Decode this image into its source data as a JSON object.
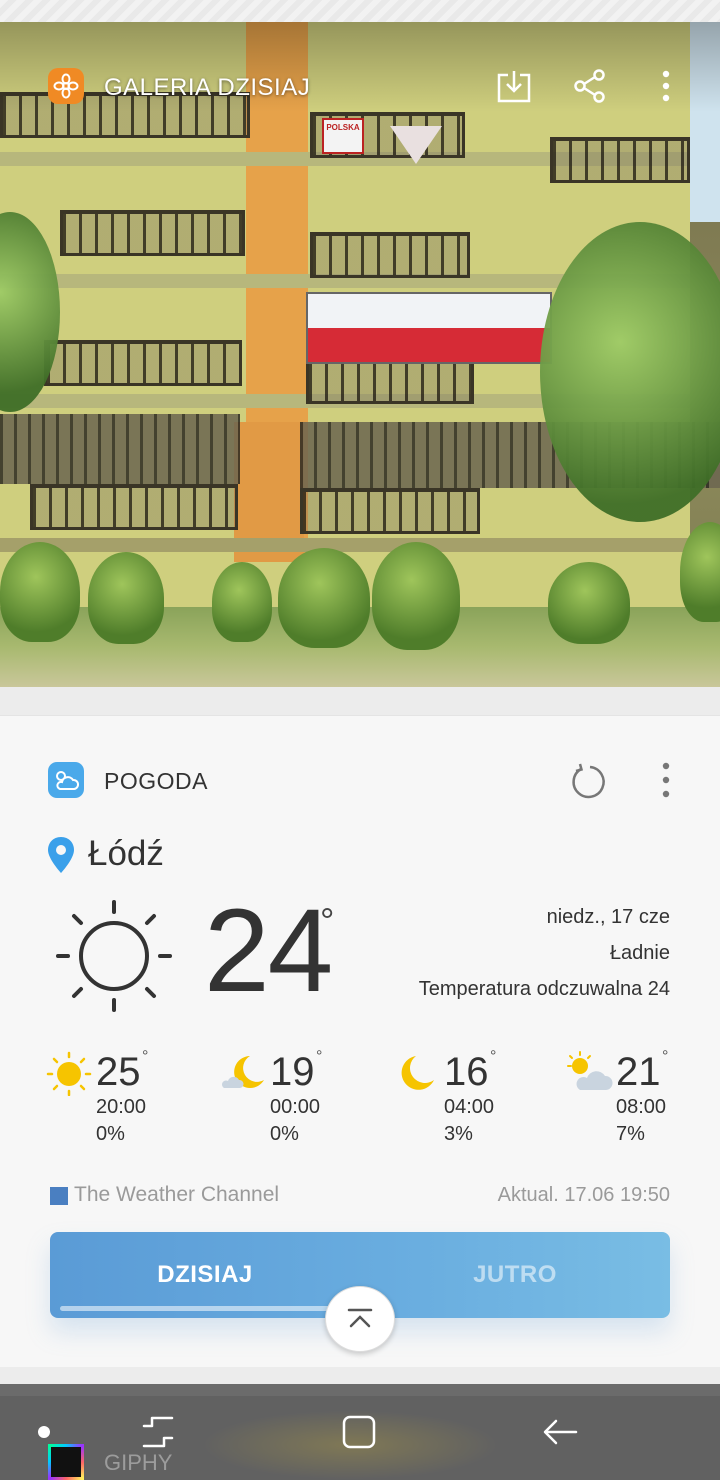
{
  "gallery": {
    "title": "GALERIA DZISIAJ",
    "flag_banner_text": "POLSKA",
    "icons": [
      "flower-icon",
      "save-to-gallery-icon",
      "share-icon",
      "more-icon"
    ]
  },
  "weather": {
    "app_title": "POGODA",
    "location": "Łódź",
    "current": {
      "temperature": "24",
      "degree_symbol": "°",
      "date": "niedz., 17 cze",
      "condition": "Ładnie",
      "feels_like": "Temperatura odczuwalna 24",
      "icon": "sun-icon"
    },
    "hourly": [
      {
        "temp": "25",
        "deg": "°",
        "time": "20:00",
        "precip": "0%",
        "icon": "sun-icon"
      },
      {
        "temp": "19",
        "deg": "°",
        "time": "00:00",
        "precip": "0%",
        "icon": "moon-cloud-icon"
      },
      {
        "temp": "16",
        "deg": "°",
        "time": "04:00",
        "precip": "3%",
        "icon": "moon-icon"
      },
      {
        "temp": "21",
        "deg": "°",
        "time": "08:00",
        "precip": "7%",
        "icon": "sun-cloud-icon"
      }
    ],
    "provider": "The Weather Channel",
    "updated": "Aktual. 17.06 19:50",
    "tabs": [
      {
        "label": "DZISIAJ",
        "selected": true
      },
      {
        "label": "JUTRO",
        "selected": false
      }
    ]
  },
  "next_card": {
    "label": "GIPHY"
  },
  "colors": {
    "accent": "#4aa9ea",
    "tabs_start": "#5a9bd6",
    "tabs_end": "#79bde4",
    "sun_yellow": "#f6c400",
    "text_dark": "#333333",
    "text_muted": "#9a9a9a"
  }
}
